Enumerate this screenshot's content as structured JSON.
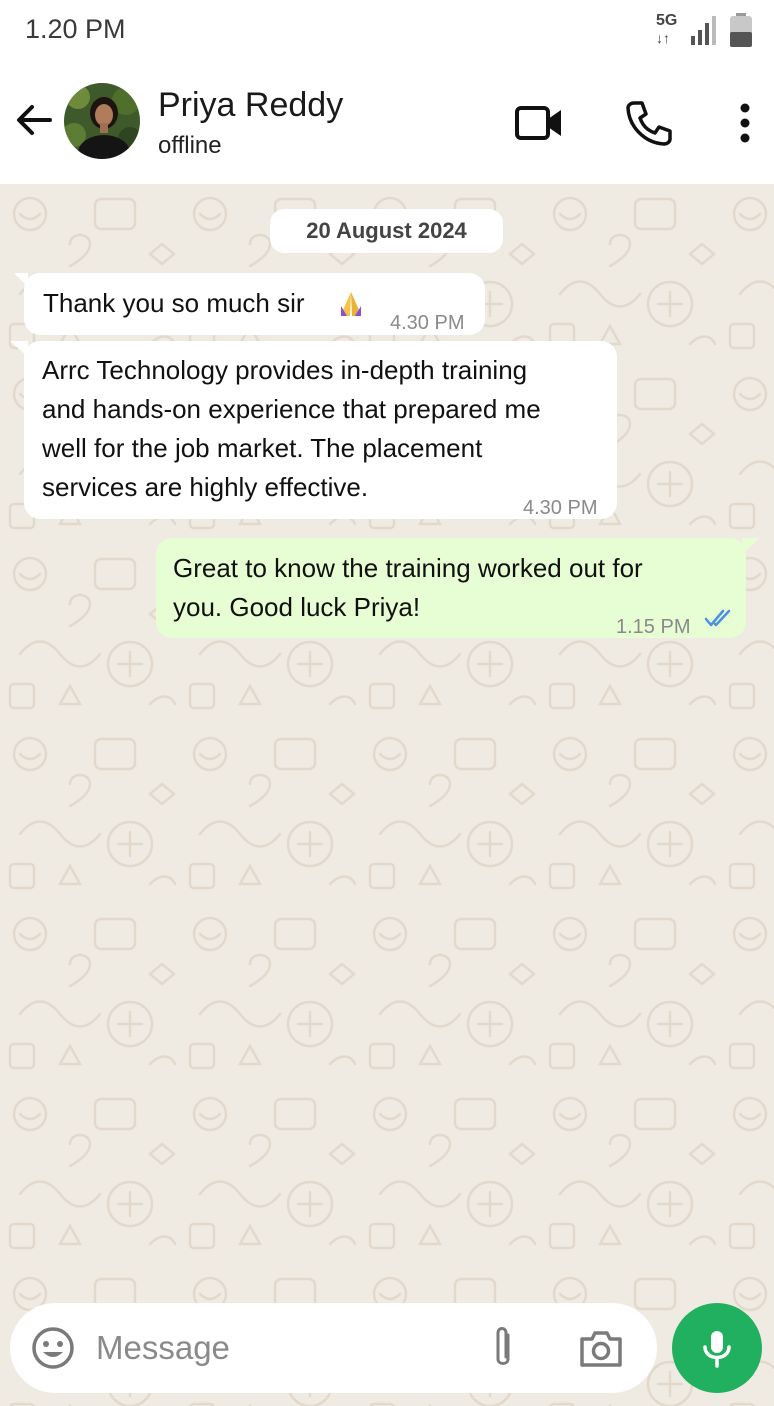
{
  "status_bar": {
    "time": "1.20 PM",
    "network": "5G"
  },
  "header": {
    "contact_name": "Priya Reddy",
    "contact_status": "offline"
  },
  "chat": {
    "date_separator": "20 August 2024",
    "messages": [
      {
        "direction": "incoming",
        "text": "Thank you so much sir",
        "emoji": "folded-hands",
        "time": "4.30 PM"
      },
      {
        "direction": "incoming",
        "lines": [
          "Arrc Technology provides in-depth training",
          "and hands-on experience that prepared me",
          "well for the job market. The placement",
          "services are highly effective."
        ],
        "time": "4.30 PM"
      },
      {
        "direction": "outgoing",
        "lines": [
          "Great to know the training worked out for",
          "you. Good luck Priya!"
        ],
        "time": "1.15 PM",
        "read_status": "read"
      }
    ]
  },
  "composer": {
    "placeholder": "Message"
  },
  "colors": {
    "accent_green": "#21b060",
    "outgoing_bubble": "#e7fdd3",
    "chat_background": "#efeae2",
    "read_ticks": "#4a90e2"
  }
}
